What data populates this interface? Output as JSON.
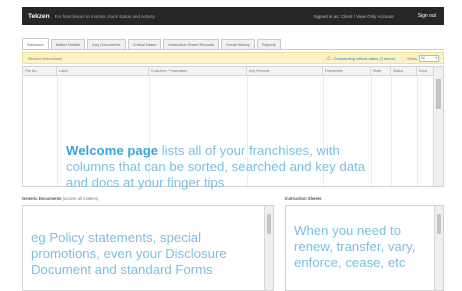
{
  "topbar": {
    "brand": "Tekzen",
    "tagline": "For franchisors to monitor, track status and activity",
    "login_status": "Signed in as: Client / View Only Account",
    "logout": "Sign out"
  },
  "tabs": [
    {
      "label": "Welcome",
      "active": true
    },
    {
      "label": "Matter Details"
    },
    {
      "label": "Key Documents"
    },
    {
      "label": "Critical Dates"
    },
    {
      "label": "Instruction Sheet Records"
    },
    {
      "label": "Email History"
    },
    {
      "label": "Reports"
    }
  ],
  "alert": {
    "notice": "Recent Instructions",
    "warning": "Outstanding critical dates (3 items)",
    "show_label": "Show",
    "show_value": "All"
  },
  "grid": {
    "columns": [
      "File No.",
      "Label",
      "Customer / Franchisee",
      "Key Persons",
      "Franchisee",
      "State",
      "Status",
      "Docs"
    ]
  },
  "welcome": {
    "bold": "Welcome page",
    "rest": " lists all of your franchises, with columns that can be sorted, searched and key data and docs at your finger tips"
  },
  "generic_docs": {
    "title": "Generic Documents",
    "subtitle": "(across all matters)",
    "body": "eg Policy statements, special promotions, even your Disclosure Document and standard Forms"
  },
  "instruction_sheets": {
    "title": "Instruction Sheets",
    "body": "When you need to renew, transfer, vary, enforce, cease, etc"
  }
}
